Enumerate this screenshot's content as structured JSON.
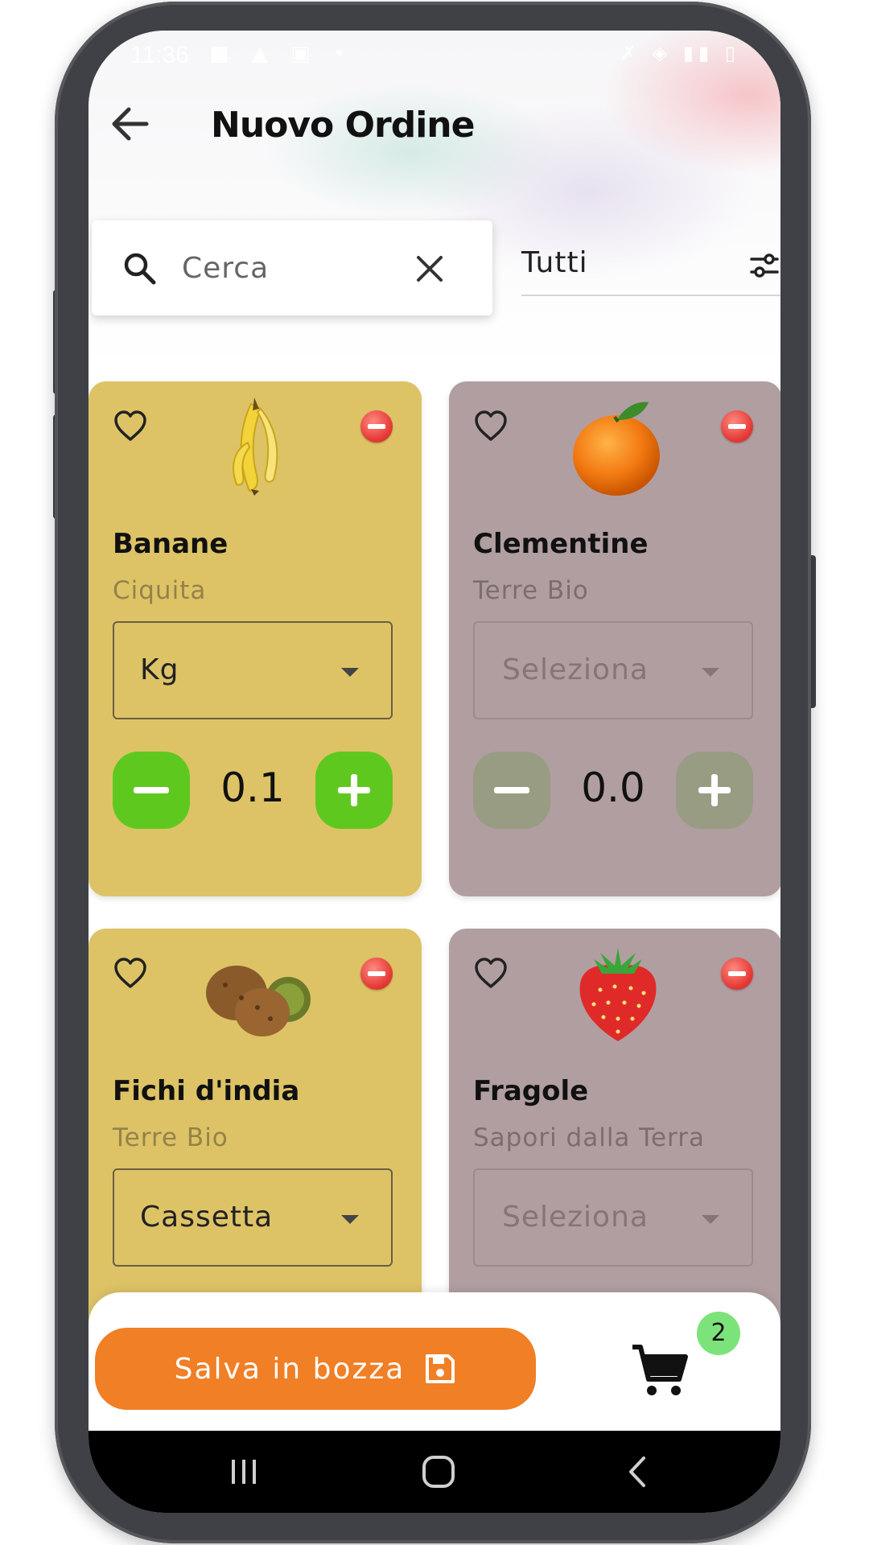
{
  "status_bar": {
    "time": "11:36"
  },
  "header": {
    "title": "Nuovo Ordine"
  },
  "search": {
    "placeholder": "Cerca"
  },
  "filter": {
    "selected": "Tutti"
  },
  "products": [
    {
      "name": "Banane",
      "brand": "Ciquita",
      "unit": "Kg",
      "quantity": "0.1",
      "state": "active",
      "icon": "banana-icon"
    },
    {
      "name": "Clementine",
      "brand": "Terre Bio",
      "unit": "Seleziona",
      "quantity": "0.0",
      "state": "inactive",
      "icon": "tangerine-icon"
    },
    {
      "name": "Fichi d'india",
      "brand": "Terre Bio",
      "unit": "Cassetta",
      "quantity": "",
      "state": "active",
      "icon": "prickly-pear-icon"
    },
    {
      "name": "Fragole",
      "brand": "Sapori dalla Terra",
      "unit": "Seleziona",
      "quantity": "",
      "state": "inactive",
      "icon": "strawberry-icon"
    }
  ],
  "bottom_bar": {
    "save_label": "Salva in bozza",
    "cart_count": "2"
  },
  "colors": {
    "active_card": "#ddc366",
    "inactive_card": "#b19ea1",
    "accent_orange": "#f07f25",
    "stepper_green": "#5fc81f"
  }
}
